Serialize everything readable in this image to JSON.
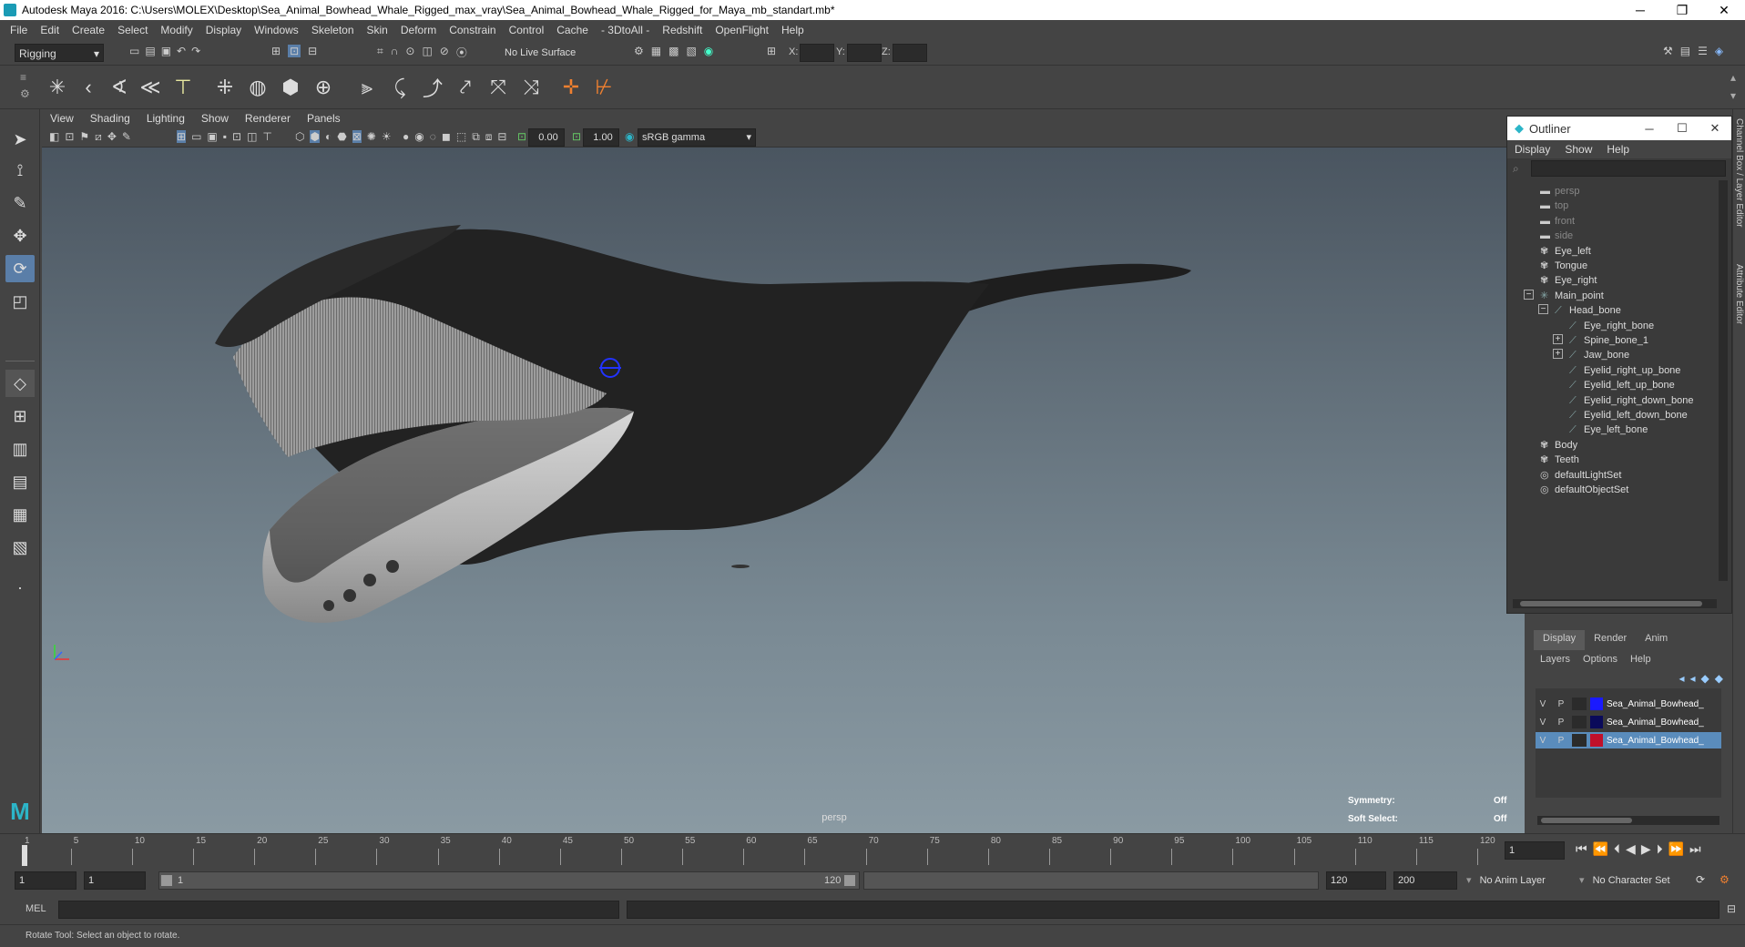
{
  "window": {
    "title": "Autodesk Maya 2016: C:\\Users\\MOLEX\\Desktop\\Sea_Animal_Bowhead_Whale_Rigged_max_vray\\Sea_Animal_Bowhead_Whale_Rigged_for_Maya_mb_standart.mb*",
    "minimize": "─",
    "maximize": "❐",
    "close": "✕"
  },
  "menubar": [
    "File",
    "Edit",
    "Create",
    "Select",
    "Modify",
    "Display",
    "Windows",
    "Skeleton",
    "Skin",
    "Deform",
    "Constrain",
    "Control",
    "Cache",
    "- 3DtoAll -",
    "Redshift",
    "OpenFlight",
    "Help"
  ],
  "statusline": {
    "menuset": "Rigging",
    "live_surface": "No Live Surface",
    "x_label": "X:",
    "y_label": "Y:",
    "z_label": "Z:"
  },
  "viewport": {
    "menu": [
      "View",
      "Shading",
      "Lighting",
      "Show",
      "Renderer",
      "Panels"
    ],
    "near_value": "0.00",
    "far_value": "1.00",
    "color_space": "sRGB gamma",
    "camera_label": "persp",
    "symmetry_label": "Symmetry:",
    "symmetry_value": "Off",
    "soft_select_label": "Soft Select:",
    "soft_select_value": "Off"
  },
  "outliner": {
    "title": "Outliner",
    "menu": [
      "Display",
      "Show",
      "Help"
    ],
    "items": [
      {
        "label": "persp",
        "dim": true,
        "indent": 0,
        "icon": "camera-icon"
      },
      {
        "label": "top",
        "dim": true,
        "indent": 0,
        "icon": "camera-icon"
      },
      {
        "label": "front",
        "dim": true,
        "indent": 0,
        "icon": "camera-icon"
      },
      {
        "label": "side",
        "dim": true,
        "indent": 0,
        "icon": "camera-icon"
      },
      {
        "label": "Eye_left",
        "dim": false,
        "indent": 0,
        "icon": "mesh-icon"
      },
      {
        "label": "Tongue",
        "dim": false,
        "indent": 0,
        "icon": "mesh-icon"
      },
      {
        "label": "Eye_right",
        "dim": false,
        "indent": 0,
        "icon": "mesh-icon"
      },
      {
        "label": "Main_point",
        "dim": false,
        "indent": 0,
        "icon": "joint-root-icon",
        "expander": "−"
      },
      {
        "label": "Head_bone",
        "dim": false,
        "indent": 1,
        "icon": "joint-icon",
        "expander": "−"
      },
      {
        "label": "Eye_right_bone",
        "dim": false,
        "indent": 2,
        "icon": "joint-icon"
      },
      {
        "label": "Spine_bone_1",
        "dim": false,
        "indent": 2,
        "icon": "joint-icon",
        "expander": "+"
      },
      {
        "label": "Jaw_bone",
        "dim": false,
        "indent": 2,
        "icon": "joint-icon",
        "expander": "+"
      },
      {
        "label": "Eyelid_right_up_bone",
        "dim": false,
        "indent": 2,
        "icon": "joint-icon"
      },
      {
        "label": "Eyelid_left_up_bone",
        "dim": false,
        "indent": 2,
        "icon": "joint-icon"
      },
      {
        "label": "Eyelid_right_down_bone",
        "dim": false,
        "indent": 2,
        "icon": "joint-icon"
      },
      {
        "label": "Eyelid_left_down_bone",
        "dim": false,
        "indent": 2,
        "icon": "joint-icon"
      },
      {
        "label": "Eye_left_bone",
        "dim": false,
        "indent": 2,
        "icon": "joint-icon"
      },
      {
        "label": "Body",
        "dim": false,
        "indent": 0,
        "icon": "mesh-icon"
      },
      {
        "label": "Teeth",
        "dim": false,
        "indent": 0,
        "icon": "mesh-icon"
      },
      {
        "label": "defaultLightSet",
        "dim": false,
        "indent": 0,
        "icon": "set-icon"
      },
      {
        "label": "defaultObjectSet",
        "dim": false,
        "indent": 0,
        "icon": "set-icon"
      }
    ]
  },
  "layer_editor": {
    "tabs": [
      "Display",
      "Render",
      "Anim"
    ],
    "menu": [
      "Layers",
      "Options",
      "Help"
    ],
    "layers": [
      {
        "v": "V",
        "p": "P",
        "name": "Sea_Animal_Bowhead_",
        "color": "#1a1aff",
        "selected": false
      },
      {
        "v": "V",
        "p": "P",
        "name": "Sea_Animal_Bowhead_",
        "color": "#0a0a5a",
        "selected": false
      },
      {
        "v": "V",
        "p": "P",
        "name": "Sea_Animal_Bowhead_",
        "color": "#c0102a",
        "selected": true
      }
    ]
  },
  "side_tabs": [
    "Channel Box / Layer Editor",
    "Attribute Editor"
  ],
  "timeline": {
    "ticks": [
      "1",
      "5",
      "10",
      "15",
      "20",
      "25",
      "30",
      "35",
      "40",
      "45",
      "50",
      "55",
      "60",
      "65",
      "70",
      "75",
      "80",
      "85",
      "90",
      "95",
      "100",
      "105",
      "110",
      "115",
      "120"
    ],
    "current_frame": "1"
  },
  "range": {
    "start": "1",
    "playback_start": "1",
    "slider_start": "1",
    "slider_end": "120",
    "playback_end": "120",
    "end": "200",
    "anim_layer": "No Anim Layer",
    "character_set": "No Character Set"
  },
  "mel": {
    "label": "MEL"
  },
  "help_line": "Rotate Tool: Select an object to rotate."
}
